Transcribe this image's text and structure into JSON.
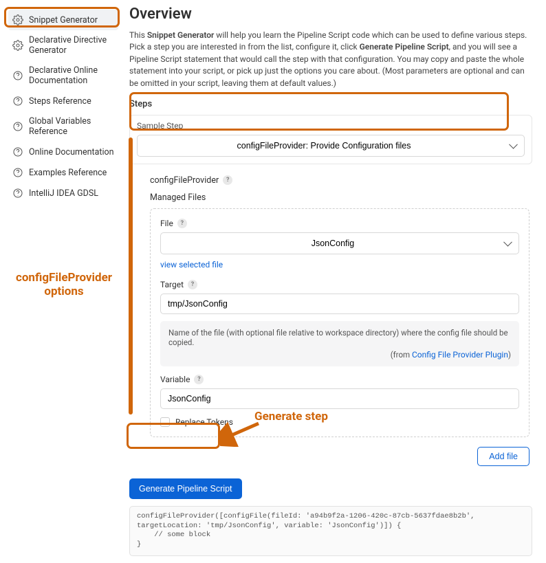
{
  "sidebar": {
    "items": [
      {
        "label": "Snippet Generator",
        "icon": "gear"
      },
      {
        "label": "Declarative Directive Generator",
        "icon": "gear"
      },
      {
        "label": "Declarative Online Documentation",
        "icon": "help"
      },
      {
        "label": "Steps Reference",
        "icon": "help"
      },
      {
        "label": "Global Variables Reference",
        "icon": "help"
      },
      {
        "label": "Online Documentation",
        "icon": "help"
      },
      {
        "label": "Examples Reference",
        "icon": "help"
      },
      {
        "label": "IntelliJ IDEA GDSL",
        "icon": "help"
      }
    ]
  },
  "page": {
    "title": "Overview",
    "intro_pre": "This ",
    "intro_b1": "Snippet Generator",
    "intro_mid1": " will help you learn the Pipeline Script code which can be used to define various steps. Pick a step you are interested in from the list, configure it, click ",
    "intro_b2": "Generate Pipeline Script",
    "intro_mid2": ", and you will see a Pipeline Script statement that would call the step with that configuration. You may copy and paste the whole statement into your script, or pick up just the options you care about. (Most parameters are optional and can be omitted in your script, leaving them at default values.)",
    "steps_heading": "Steps"
  },
  "sample": {
    "label": "Sample Step",
    "value": "configFileProvider: Provide Configuration files"
  },
  "config": {
    "header": "configFileProvider",
    "managed_files": "Managed Files",
    "file_label": "File",
    "file_value": "JsonConfig",
    "view_link": "view selected file",
    "target_label": "Target",
    "target_value": "tmp/JsonConfig",
    "note_text": "Name of the file (with optional file relative to workspace directory) where the config file should be copied.",
    "note_from_prefix": "(from ",
    "note_from_link": "Config File Provider Plugin",
    "note_from_suffix": ")",
    "variable_label": "Variable",
    "variable_value": "JsonConfig",
    "replace_label": "Replace Tokens",
    "add_file": "Add file"
  },
  "generate": {
    "button": "Generate Pipeline Script",
    "output": "configFileProvider([configFile(fileId: 'a94b9f2a-1206-420c-87cb-5637fdae8b2b', targetLocation: 'tmp/JsonConfig', variable: 'JsonConfig')]) {\n    // some block\n}"
  },
  "annotations": {
    "options": "configFileProvider\noptions",
    "generate": "Generate step"
  }
}
